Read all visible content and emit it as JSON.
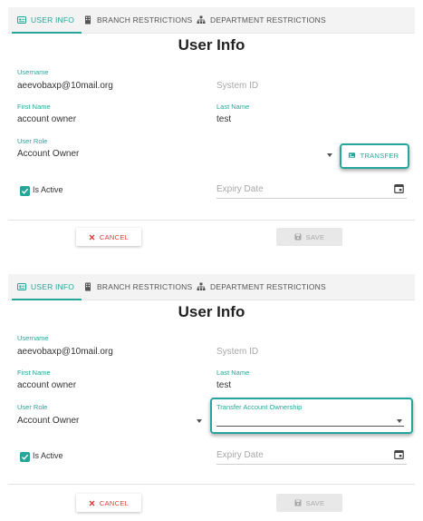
{
  "colors": {
    "accent": "#26a69a",
    "danger": "#e53935",
    "muted": "#a8a8a8"
  },
  "tabs": {
    "user_info": "USER INFO",
    "branch_restrictions": "BRANCH RESTRICTIONS",
    "department_restrictions": "DEPARTMENT RESTRICTIONS"
  },
  "form": {
    "title": "User Info",
    "username_label": "Username",
    "username_value": "aeevobaxp@10mail.org",
    "system_id_placeholder": "System ID",
    "first_name_label": "First Name",
    "first_name_value": "account owner",
    "last_name_label": "Last Name",
    "last_name_value": "test",
    "user_role_label": "User Role",
    "user_role_value": "Account Owner",
    "is_active_label": "Is Active",
    "is_active_checked": true,
    "expiry_placeholder": "Expiry Date",
    "cancel_label": "CANCEL",
    "save_label": "SAVE",
    "transfer_label": "TRANSFER",
    "transfer_ownership_label": "Transfer Account Ownership",
    "transfer_ownership_value": ""
  },
  "icons": {
    "user_info_tab": "id-card-icon",
    "branch_tab": "building-icon",
    "department_tab": "sitemap-icon",
    "calendar": "calendar-icon",
    "cancel": "close-icon",
    "save": "floppy-icon",
    "transfer": "id-card-icon",
    "checkbox": "check-icon",
    "dropdown": "caret-down-icon"
  }
}
